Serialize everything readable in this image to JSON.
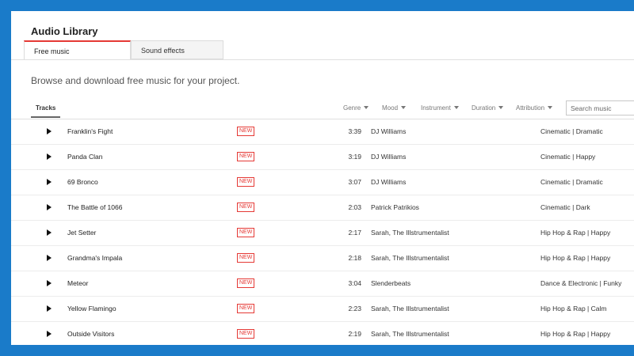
{
  "header": {
    "title": "Audio Library",
    "tabs": [
      {
        "label": "Free music",
        "active": true
      },
      {
        "label": "Sound effects",
        "active": false
      }
    ]
  },
  "subtitle": "Browse and download free music for your project.",
  "filters": {
    "tracks_label": "Tracks",
    "genre": "Genre",
    "mood": "Mood",
    "instrument": "Instrument",
    "duration": "Duration",
    "attribution": "Attribution",
    "search_placeholder": "Search music"
  },
  "colors": {
    "accent": "#e53935",
    "background": "#1a7bc9"
  },
  "tracks": [
    {
      "name": "Franklin's Fight",
      "badge": "NEW",
      "duration": "3:39",
      "artist": "DJ Williams",
      "genre_mood": "Cinematic | Dramatic"
    },
    {
      "name": "Panda Clan",
      "badge": "NEW",
      "duration": "3:19",
      "artist": "DJ Williams",
      "genre_mood": "Cinematic | Happy"
    },
    {
      "name": "69 Bronco",
      "badge": "NEW",
      "duration": "3:07",
      "artist": "DJ Williams",
      "genre_mood": "Cinematic | Dramatic"
    },
    {
      "name": "The Battle of 1066",
      "badge": "NEW",
      "duration": "2:03",
      "artist": "Patrick Patrikios",
      "genre_mood": "Cinematic | Dark"
    },
    {
      "name": "Jet Setter",
      "badge": "NEW",
      "duration": "2:17",
      "artist": "Sarah, The Illstrumentalist",
      "genre_mood": "Hip Hop & Rap | Happy"
    },
    {
      "name": "Grandma's Impala",
      "badge": "NEW",
      "duration": "2:18",
      "artist": "Sarah, The Illstrumentalist",
      "genre_mood": "Hip Hop & Rap | Happy"
    },
    {
      "name": "Meteor",
      "badge": "NEW",
      "duration": "3:04",
      "artist": "Slenderbeats",
      "genre_mood": "Dance & Electronic | Funky"
    },
    {
      "name": "Yellow Flamingo",
      "badge": "NEW",
      "duration": "2:23",
      "artist": "Sarah, The Illstrumentalist",
      "genre_mood": "Hip Hop & Rap | Calm"
    },
    {
      "name": "Outside Visitors",
      "badge": "NEW",
      "duration": "2:19",
      "artist": "Sarah, The Illstrumentalist",
      "genre_mood": "Hip Hop & Rap | Happy"
    }
  ]
}
